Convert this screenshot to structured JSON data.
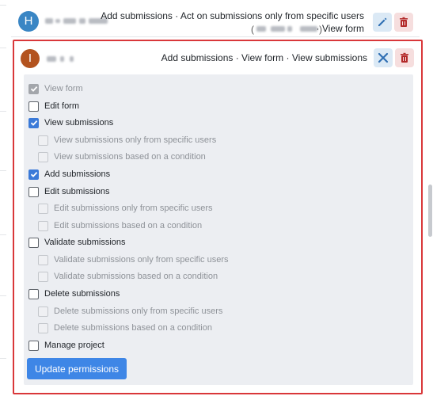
{
  "members": [
    {
      "initial": "H",
      "permissions_summary": "Add submissions · Act on submissions only from specific users",
      "permissions_summary_2": "· View form",
      "avatar_color": "#3a86c4"
    },
    {
      "initial": "I",
      "permissions_summary": "Add submissions · View form · View submissions",
      "avatar_color": "#b3531f"
    }
  ],
  "permission_options": [
    {
      "label": "View form",
      "state": "checked-disabled"
    },
    {
      "label": "Edit form",
      "state": "unchecked"
    },
    {
      "label": "View submissions",
      "state": "checked"
    },
    {
      "label": "View submissions only from specific users",
      "state": "disabled"
    },
    {
      "label": "View submissions based on a condition",
      "state": "disabled"
    },
    {
      "label": "Add submissions",
      "state": "checked"
    },
    {
      "label": "Edit submissions",
      "state": "unchecked"
    },
    {
      "label": "Edit submissions only from specific users",
      "state": "disabled"
    },
    {
      "label": "Edit submissions based on a condition",
      "state": "disabled"
    },
    {
      "label": "Validate submissions",
      "state": "unchecked"
    },
    {
      "label": "Validate submissions only from specific users",
      "state": "disabled"
    },
    {
      "label": "Validate submissions based on a condition",
      "state": "disabled"
    },
    {
      "label": "Delete submissions",
      "state": "unchecked"
    },
    {
      "label": "Delete submissions only from specific users",
      "state": "disabled"
    },
    {
      "label": "Delete submissions based on a condition",
      "state": "disabled"
    },
    {
      "label": "Manage project",
      "state": "unchecked"
    }
  ],
  "update_button_label": "Update permissions",
  "icons": {
    "edit": "pencil-icon",
    "delete": "trash-icon",
    "close": "close-icon"
  },
  "colors": {
    "accent": "#3e86e6",
    "highlight_border": "#d9373a",
    "delete": "#b32a2a",
    "edit": "#2f6fb3"
  }
}
